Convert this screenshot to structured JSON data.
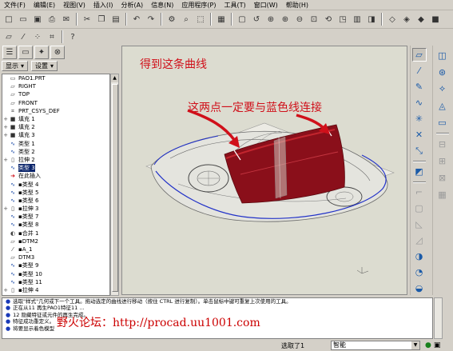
{
  "menu": [
    "文件(F)",
    "编辑(E)",
    "视图(V)",
    "插入(I)",
    "分析(A)",
    "信息(N)",
    "应用程序(P)",
    "工具(T)",
    "窗口(W)",
    "帮助(H)"
  ],
  "toolbar": {
    "row1": [
      {
        "name": "new-icon",
        "glyph": "□"
      },
      {
        "name": "open-icon",
        "glyph": "▭"
      },
      {
        "name": "save-icon",
        "glyph": "▣"
      },
      {
        "name": "print-icon",
        "glyph": "⎙"
      },
      {
        "name": "email-icon",
        "glyph": "✉"
      },
      {
        "name": "sep"
      },
      {
        "name": "cut-icon",
        "glyph": "✂"
      },
      {
        "name": "copy-icon",
        "glyph": "❐"
      },
      {
        "name": "paste-icon",
        "glyph": "▤"
      },
      {
        "name": "sep"
      },
      {
        "name": "undo-icon",
        "glyph": "↶"
      },
      {
        "name": "redo-icon",
        "glyph": "↷"
      },
      {
        "name": "sep"
      },
      {
        "name": "regenerate-icon",
        "glyph": "⚙"
      },
      {
        "name": "find-icon",
        "glyph": "⌕"
      },
      {
        "name": "select-box-icon",
        "glyph": "⬚"
      },
      {
        "name": "sep"
      },
      {
        "name": "display-style-icon",
        "glyph": "▦"
      },
      {
        "name": "sep"
      },
      {
        "name": "repaint-icon",
        "glyph": "▢"
      },
      {
        "name": "orient-icon",
        "glyph": "↺"
      },
      {
        "name": "spin-center-icon",
        "glyph": "⊕"
      },
      {
        "name": "zoom-in-icon",
        "glyph": "⊕"
      },
      {
        "name": "zoom-out-icon",
        "glyph": "⊖"
      },
      {
        "name": "refit-icon",
        "glyph": "⊡"
      },
      {
        "name": "reorient-icon",
        "glyph": "⟲"
      },
      {
        "name": "saved-views-icon",
        "glyph": "◳"
      },
      {
        "name": "layers-icon",
        "glyph": "▥"
      },
      {
        "name": "view-manager-icon",
        "glyph": "◨"
      },
      {
        "name": "sep"
      },
      {
        "name": "wireframe-icon",
        "glyph": "◇"
      },
      {
        "name": "hidden-line-icon",
        "glyph": "◈"
      },
      {
        "name": "no-hidden-icon",
        "glyph": "◆"
      },
      {
        "name": "shading-icon",
        "glyph": "■"
      }
    ],
    "row2": [
      {
        "name": "datum-planes-icon",
        "glyph": "▱"
      },
      {
        "name": "datum-axes-icon",
        "glyph": "⁄"
      },
      {
        "name": "datum-points-icon",
        "glyph": "⁘"
      },
      {
        "name": "datum-csys-icon",
        "glyph": "⌗"
      },
      {
        "name": "sep"
      },
      {
        "name": "context-help-icon",
        "glyph": "?"
      }
    ]
  },
  "panel_tabs": [
    {
      "name": "model-tree-tab-icon",
      "glyph": "☰"
    },
    {
      "name": "folder-browser-tab-icon",
      "glyph": "▭"
    },
    {
      "name": "favorites-tab-icon",
      "glyph": "✦"
    },
    {
      "name": "connections-tab-icon",
      "glyph": "⊗"
    }
  ],
  "tree_controls": {
    "show": "显示",
    "settings": "设置"
  },
  "model_tree": [
    {
      "label": "PAO1.PRT",
      "icon": "▭",
      "exp": ""
    },
    {
      "label": "RIGHT",
      "icon": "▱",
      "exp": ""
    },
    {
      "label": "TOP",
      "icon": "▱",
      "exp": ""
    },
    {
      "label": "FRONT",
      "icon": "▱",
      "exp": ""
    },
    {
      "label": "PRT_CSYS_DEF",
      "icon": "⌗",
      "exp": ""
    },
    {
      "label": "填充 1",
      "icon": "■",
      "exp": "+"
    },
    {
      "label": "填充 2",
      "icon": "■",
      "exp": "+"
    },
    {
      "label": "填充 3",
      "icon": "■",
      "exp": "+"
    },
    {
      "label": "类型 1",
      "icon": "∿",
      "exp": ""
    },
    {
      "label": "类型 2",
      "icon": "∿",
      "exp": ""
    },
    {
      "label": "拉伸 2",
      "icon": "▯",
      "exp": "+"
    },
    {
      "label": "类型 3",
      "icon": "∿",
      "exp": "",
      "selected": true
    },
    {
      "label": "在此插入",
      "icon": "➜",
      "exp": ""
    },
    {
      "label": "▪类型 4",
      "icon": "∿",
      "exp": ""
    },
    {
      "label": "▪类型 5",
      "icon": "∿",
      "exp": ""
    },
    {
      "label": "▪类型 6",
      "icon": "∿",
      "exp": ""
    },
    {
      "label": "▪拉伸 3",
      "icon": "▯",
      "exp": "+"
    },
    {
      "label": "▪类型 7",
      "icon": "∿",
      "exp": ""
    },
    {
      "label": "▪类型 8",
      "icon": "∿",
      "exp": ""
    },
    {
      "label": "▪合并 1",
      "icon": "◐",
      "exp": ""
    },
    {
      "label": "▪DTM2",
      "icon": "▱",
      "exp": ""
    },
    {
      "label": "▪A_1",
      "icon": "⁄",
      "exp": ""
    },
    {
      "label": "DTM3",
      "icon": "▱",
      "exp": ""
    },
    {
      "label": "▪类型 9",
      "icon": "∿",
      "exp": ""
    },
    {
      "label": "▪类型 10",
      "icon": "∿",
      "exp": ""
    },
    {
      "label": "▪类型 11",
      "icon": "∿",
      "exp": ""
    },
    {
      "label": "▪拉伸 4",
      "icon": "▯",
      "exp": "+"
    }
  ],
  "viewport": {
    "annotation_1": "得到这条曲线",
    "annotation_2": "这两点一定要与蓝色线连接",
    "colors": {
      "surface": "#8a0f1a",
      "surface_edge": "#c2252e",
      "curve": "#2232c8",
      "annotation": "#d0101a"
    }
  },
  "right_toolbar_1": [
    {
      "name": "datum-plane-tool-icon",
      "glyph": "▱",
      "on": true
    },
    {
      "name": "datum-axis-tool-icon",
      "glyph": "⁄"
    },
    {
      "name": "sketch-tool-icon",
      "glyph": "✎"
    },
    {
      "name": "curve-tool-icon",
      "glyph": "∿"
    },
    {
      "name": "datum-point-tool-icon",
      "glyph": "✳"
    },
    {
      "name": "csys-tool-icon",
      "glyph": "✕"
    },
    {
      "name": "analysis-tool-icon",
      "glyph": "⤡"
    },
    {
      "name": "sep"
    },
    {
      "name": "annotation-tool-icon",
      "glyph": "◩"
    },
    {
      "name": "sep"
    },
    {
      "name": "round-tool-icon",
      "glyph": "⌐",
      "dim": true
    },
    {
      "name": "shell-tool-icon",
      "glyph": "▢",
      "dim": true
    },
    {
      "name": "draft-tool-icon",
      "glyph": "◺",
      "dim": true
    },
    {
      "name": "rib-tool-icon",
      "glyph": "◿",
      "dim": true
    },
    {
      "name": "pattern-tool-icon",
      "glyph": "◑"
    },
    {
      "name": "style-tool-icon",
      "glyph": "◔"
    },
    {
      "name": "mirror-tool-icon",
      "glyph": "◒"
    }
  ],
  "right_toolbar_2": [
    {
      "name": "extrude-tool-icon",
      "glyph": "◫"
    },
    {
      "name": "revolve-tool-icon",
      "glyph": "⊛"
    },
    {
      "name": "sweep-tool-icon",
      "glyph": "⟡"
    },
    {
      "name": "blend-tool-icon",
      "glyph": "◬"
    },
    {
      "name": "boundary-tool-icon",
      "glyph": "▭"
    },
    {
      "name": "sep"
    },
    {
      "name": "trim-tool-icon",
      "glyph": "⊟",
      "dim": true
    },
    {
      "name": "merge-tool-icon",
      "glyph": "⊞",
      "dim": true
    },
    {
      "name": "intersect-tool-icon",
      "glyph": "⊠",
      "dim": true
    },
    {
      "name": "project-tool-icon",
      "glyph": "▦",
      "dim": true
    }
  ],
  "messages": [
    "选取\"样式\"几何或下一个工具。拖动选定的曲线进行移动（按住 CTRL 进行复制）。单击鼠标中键可重复上次使用的工具。",
    "正在从11 再生PAO1特征11 ...",
    "12 隐藏特征或元件的再生完成。",
    "特征成功重定义。",
    "将要显示着色模型"
  ],
  "watermark": "野火论坛：http://procad.uu1001.com",
  "status": {
    "selected": "选取了1",
    "filter": "智能"
  }
}
